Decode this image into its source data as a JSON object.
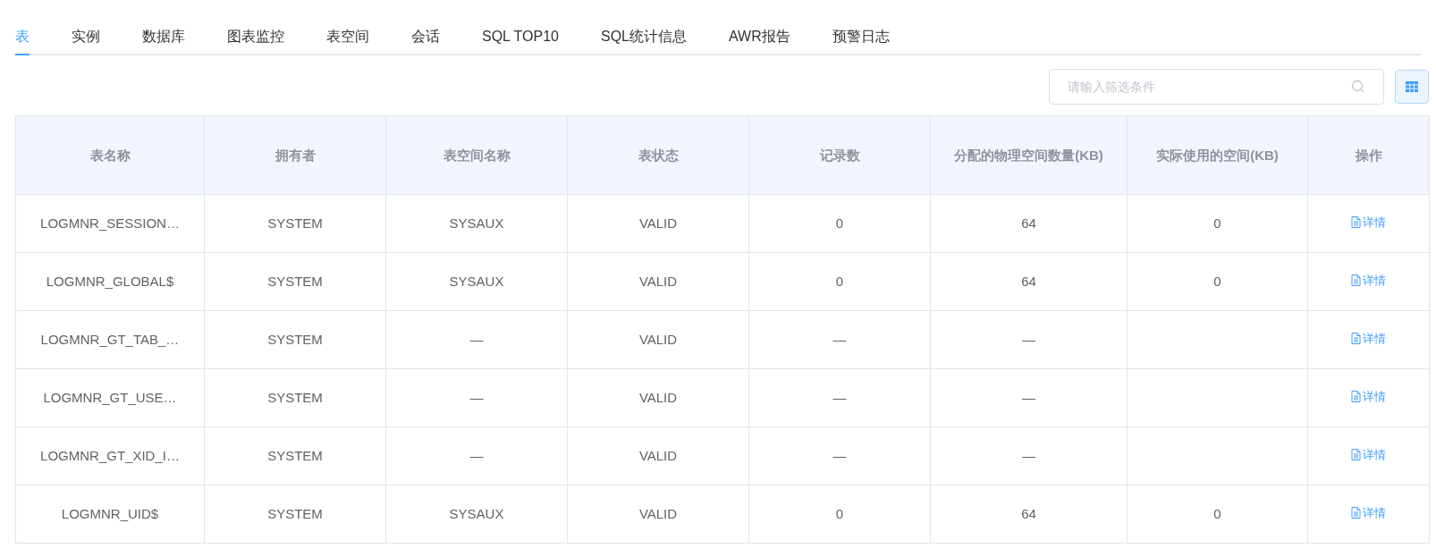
{
  "tabs": [
    {
      "label": "表",
      "selected": true
    },
    {
      "label": "实例",
      "selected": false
    },
    {
      "label": "数据库",
      "selected": false
    },
    {
      "label": "图表监控",
      "selected": false
    },
    {
      "label": "表空间",
      "selected": false
    },
    {
      "label": "会话",
      "selected": false
    },
    {
      "label": "SQL TOP10",
      "selected": false
    },
    {
      "label": "SQL统计信息",
      "selected": false
    },
    {
      "label": "AWR报告",
      "selected": false
    },
    {
      "label": "预警日志",
      "selected": false
    }
  ],
  "search": {
    "placeholder": "请输入筛选条件"
  },
  "table": {
    "columns": [
      "表名称",
      "拥有者",
      "表空间名称",
      "表状态",
      "记录数",
      "分配的物理空间数量(KB)",
      "实际使用的空间(KB)",
      "操作"
    ],
    "rows": [
      {
        "cells": [
          "LOGMNR_SESSION…",
          "SYSTEM",
          "SYSAUX",
          "VALID",
          "0",
          "64",
          "0"
        ],
        "action": "详情"
      },
      {
        "cells": [
          "LOGMNR_GLOBAL$",
          "SYSTEM",
          "SYSAUX",
          "VALID",
          "0",
          "64",
          "0"
        ],
        "action": "详情"
      },
      {
        "cells": [
          "LOGMNR_GT_TAB_…",
          "SYSTEM",
          "—",
          "VALID",
          "—",
          "—",
          null
        ],
        "action": "详情"
      },
      {
        "cells": [
          "LOGMNR_GT_USE…",
          "SYSTEM",
          "—",
          "VALID",
          "—",
          "—",
          null
        ],
        "action": "详情"
      },
      {
        "cells": [
          "LOGMNR_GT_XID_I…",
          "SYSTEM",
          "—",
          "VALID",
          "—",
          "—",
          null
        ],
        "action": "详情"
      },
      {
        "cells": [
          "LOGMNR_UID$",
          "SYSTEM",
          "SYSAUX",
          "VALID",
          "0",
          "64",
          "0"
        ],
        "action": "详情"
      }
    ]
  }
}
